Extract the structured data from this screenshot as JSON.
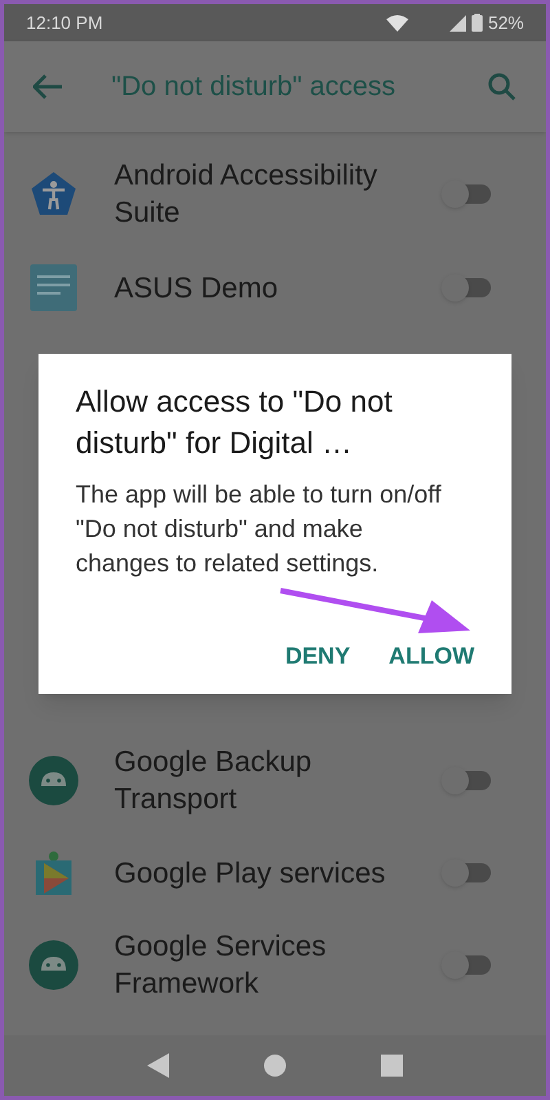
{
  "status_bar": {
    "time": "12:10 PM",
    "battery": "52%"
  },
  "app_bar": {
    "title": "\"Do not disturb\" access"
  },
  "apps_top": [
    {
      "name": "Android Accessibility Suite",
      "kind": "accessibility",
      "on": false
    },
    {
      "name": "ASUS Demo",
      "kind": "demo",
      "on": false
    }
  ],
  "apps_bottom": [
    {
      "name": "Google Backup Transport",
      "kind": "android",
      "on": false
    },
    {
      "name": "Google Play services",
      "kind": "play",
      "on": false
    },
    {
      "name": "Google Services Framework",
      "kind": "android",
      "on": false
    }
  ],
  "dialog": {
    "title": "Allow access to \"Do not disturb\" for Digital …",
    "message": "The app will be able to turn on/off \"Do not disturb\" and make changes to related settings.",
    "buttons": [
      "DENY",
      "ALLOW"
    ]
  }
}
